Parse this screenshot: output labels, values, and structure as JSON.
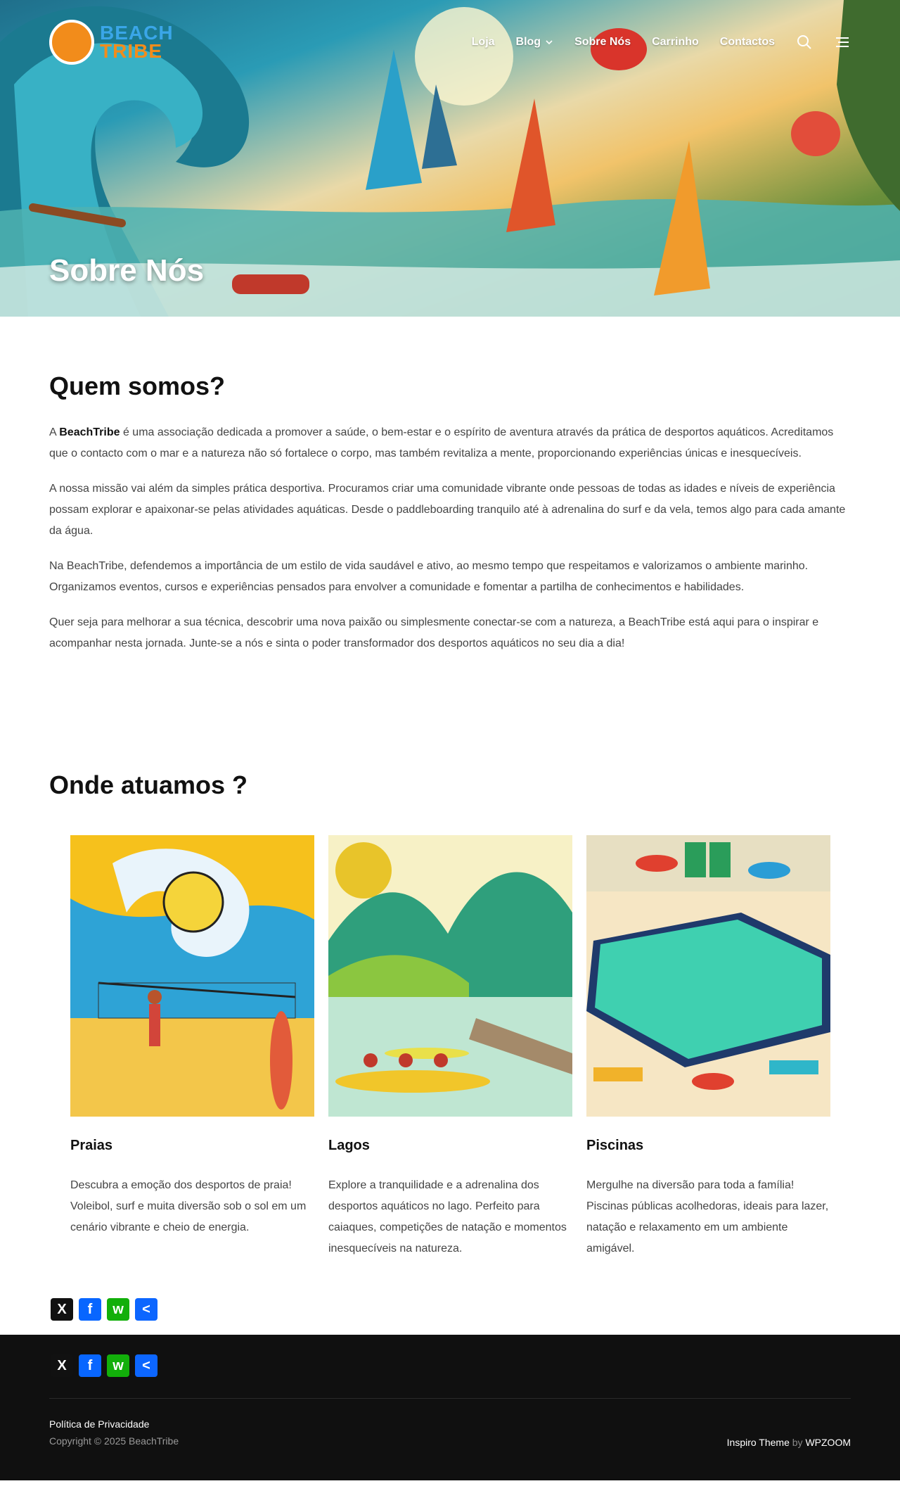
{
  "brand": {
    "line1": "BEACH",
    "line2": "TRIBE"
  },
  "nav": {
    "items": [
      "Loja",
      "Blog",
      "Sobre Nós",
      "Carrinho",
      "Contactos"
    ]
  },
  "hero": {
    "title": "Sobre Nós"
  },
  "about": {
    "heading": "Quem somos?",
    "p1_a": "A ",
    "p1_brand": "BeachTribe",
    "p1_b": " é uma associação dedicada a promover a saúde, o bem-estar e o espírito de aventura através da prática de desportos aquáticos. Acreditamos que o contacto com o mar e a natureza não só fortalece o corpo, mas também revitaliza a mente, proporcionando experiências únicas e inesquecíveis.",
    "p2": "A nossa missão vai além da simples prática desportiva. Procuramos criar uma comunidade vibrante onde pessoas de todas as idades e níveis de experiência possam explorar e apaixonar-se pelas atividades aquáticas. Desde o paddleboarding tranquilo até à adrenalina do surf e da vela, temos algo para cada amante da água.",
    "p3": "Na BeachTribe, defendemos a importância de um estilo de vida saudável e ativo, ao mesmo tempo que respeitamos e valorizamos o ambiente marinho. Organizamos eventos, cursos e experiências pensados para envolver a comunidade e fomentar a partilha de conhecimentos e habilidades.",
    "p4": "Quer seja para melhorar a sua técnica, descobrir uma nova paixão ou simplesmente conectar-se com a natureza, a BeachTribe está aqui para o inspirar e acompanhar nesta jornada. Junte-se a nós e sinta o poder transformador dos desportos aquáticos no seu dia a dia!"
  },
  "where": {
    "heading": "Onde atuamos ?",
    "cards": [
      {
        "title": "Praias",
        "text": "Descubra a emoção dos desportos de praia! Voleibol, surf e muita diversão sob o sol em um cenário vibrante e cheio de energia."
      },
      {
        "title": "Lagos",
        "text": "Explore a tranquilidade e a adrenalina dos desportos aquáticos no lago. Perfeito para caiaques, competições de natação e momentos inesquecíveis na natureza."
      },
      {
        "title": "Piscinas",
        "text": "Mergulhe na diversão para toda a família! Piscinas públicas acolhedoras, ideais para lazer, natação e relaxamento em um ambiente amigável."
      }
    ]
  },
  "share": {
    "x": "X",
    "facebook": "f",
    "whatsapp": "w",
    "share": "<"
  },
  "footer": {
    "privacy": "Política de Privacidade",
    "copyright": "Copyright © 2025 BeachTribe",
    "theme": "Inspiro Theme",
    "by": "by",
    "vendor": "WPZOOM"
  },
  "colors": {
    "x": "#111111",
    "facebook": "#0866ff",
    "whatsapp": "#12af0a",
    "share": "#0c66ff"
  }
}
